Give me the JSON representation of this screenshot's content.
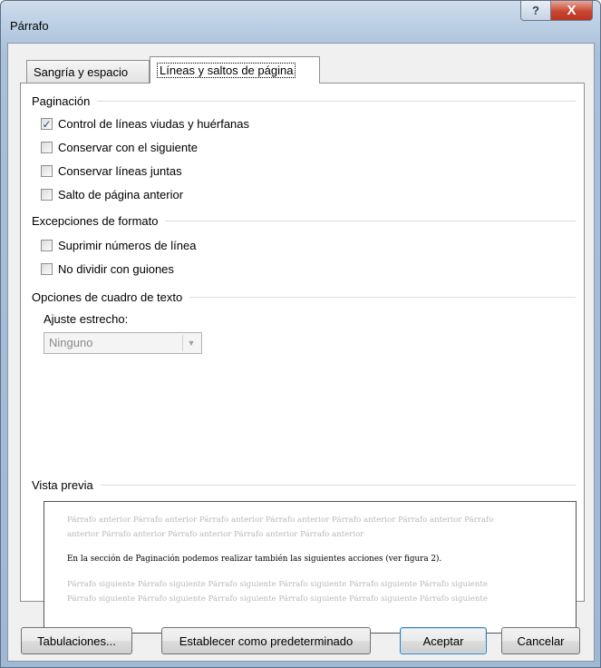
{
  "window": {
    "title": "Párrafo"
  },
  "title_buttons": {
    "help_glyph": "?",
    "close_glyph": "X"
  },
  "tabs": [
    {
      "label": "Sangría y espacio",
      "selected": false
    },
    {
      "label": "Líneas y saltos de página",
      "selected": true
    }
  ],
  "pagination": {
    "heading": "Paginación",
    "options": [
      {
        "label": "Control de líneas viudas y huérfanas",
        "checked": true
      },
      {
        "label": "Conservar con el siguiente",
        "checked": false
      },
      {
        "label": "Conservar líneas juntas",
        "checked": false
      },
      {
        "label": "Salto de página anterior",
        "checked": false
      }
    ]
  },
  "format_exceptions": {
    "heading": "Excepciones de formato",
    "options": [
      {
        "label": "Suprimir números de línea",
        "checked": false
      },
      {
        "label": "No dividir con guiones",
        "checked": false
      }
    ]
  },
  "textbox_options": {
    "heading": "Opciones de cuadro de texto",
    "tight_wrap_label": "Ajuste estrecho:",
    "tight_wrap_value": "Ninguno"
  },
  "preview": {
    "heading": "Vista previa",
    "prev_line1": "Párrafo anterior Párrafo anterior Párrafo anterior Párrafo anterior Párrafo anterior Párrafo anterior Párrafo",
    "prev_line2": "anterior Párrafo anterior Párrafo anterior Párrafo anterior Párrafo anterior",
    "main_text": "En la sección de Paginación podemos realizar también las siguientes acciones (ver figura 2).",
    "next_line1": "Párrafo siguiente Párrafo siguiente Párrafo siguiente Párrafo siguiente Párrafo siguiente Párrafo siguiente",
    "next_line2": "Párrafo siguiente Párrafo siguiente Párrafo siguiente Párrafo siguiente Párrafo siguiente Párrafo siguiente"
  },
  "buttons": {
    "tabs": "Tabulaciones...",
    "set_default": "Establecer como predeterminado",
    "ok": "Aceptar",
    "cancel": "Cancelar"
  }
}
